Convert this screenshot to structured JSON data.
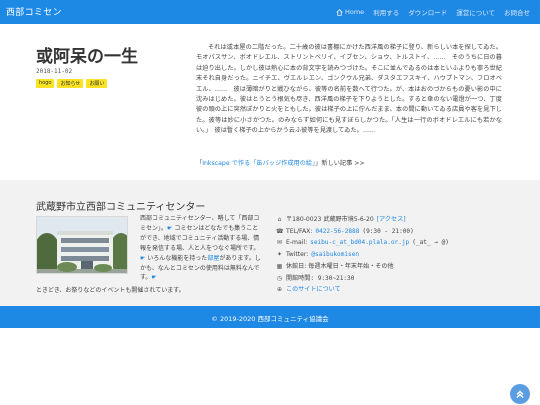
{
  "navbar": {
    "brand": "西部コミセン",
    "items": [
      {
        "label": "Home",
        "icon": "home-icon"
      },
      {
        "label": "利用する"
      },
      {
        "label": "ダウンロード"
      },
      {
        "label": "運営について"
      },
      {
        "label": "お問合せ"
      }
    ]
  },
  "post": {
    "title": "或阿呆の一生",
    "date": "2018-11-02",
    "tags": [
      "hogo",
      "お知らせ",
      "お願い"
    ],
    "excerpt": "それは或本屋の二階だった。二十歳の彼は書棚にかけた西洋風の梯子に登り、新らしい本を探してゐた。モオパスサン、ボオドレエル、ストリントベリイ、イブセン、ショウ、トルストイ、……　そのうちに日の暮は迫り出した。しかし彼は熱心に本の背文字を読みつづけた。そこに並んでゐるのは本といふよりも寧ろ世紀末それ自身だった。ニイチエ、ヴエルレエン、ゴンクウル兄弟、ダスタエフスキイ、ハウプトマン、フロオベエル、……　彼は薄暗がりと戦ひながら、彼等の名前を数へて行つた。が、本はおのづからもの憂い影の中に沈みはじめた。彼はとうとう根気も尽き、西洋風の梯子を下りようとした。すると傘のない電燈が一つ、丁度彼の頭の上に突然ぽかりと火をともした。彼は梯子の上に佇んだまま、本の間に動いてゐる店員や客を見下した。彼等は妙に小さかつた。のみならず如何にも見すぼらしかつた。「人生は一行のボオドレエルにも若かない。」　彼は暫く梯子の上からかう云ふ彼等を見渡してゐた。……",
    "next_prefix": "「",
    "next_link": "Inkscape で作る「缶バッジ作成用の絵」",
    "next_suffix": "」新しい記事 >>"
  },
  "footer": {
    "title": "武蔵野市立西部コミュニティセンター",
    "about_parts": [
      "西部コミュニティセンター、略して「西部コミセン」。",
      " コミセンはどなたでも集うことができ、地域でコミュニティ活動する場、情報を発信する場、人と人をつなぐ場所です。",
      " いろんな機能を持った",
      "部屋",
      "があります。しかも、なんとコミセンの使用料は無料なんです。"
    ],
    "about_more": " ときどき、お祭りなどのイベントも開催されています。",
    "contact": {
      "address": "〒180-0023 武蔵野市境5-6-20",
      "access_link": "[アクセス]",
      "tel_label": "TEL/FAX:",
      "tel": "0422-56-2888",
      "tel_hours": "(9:30 - 21:00)",
      "email_label": "E-mail:",
      "email": "seibu-c_at_bd04.plala.or.jp",
      "email_note": "(_at_ → @)",
      "twitter_label": "Twitter:",
      "twitter": "@saibukomisen",
      "closed": "休館日: 毎週木曜日・年末年始・その他",
      "hours": "開館時間: 9:30~21:30",
      "site_link": "このサイトについて"
    }
  },
  "copyright": "© 2019-2020 西部コミュニティ協議会",
  "colors": {
    "primary": "#1e88e5",
    "tag": "#f9e322",
    "footer_bg": "#f2f2f2"
  }
}
